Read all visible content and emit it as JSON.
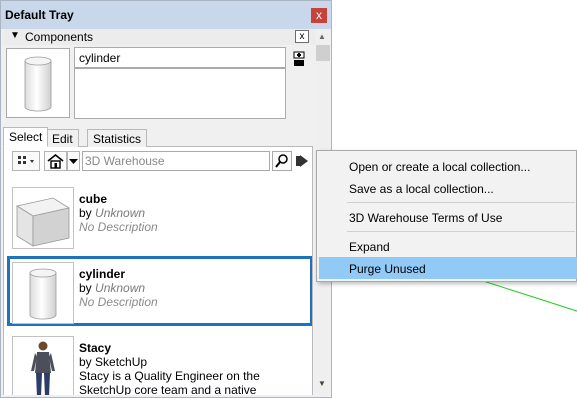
{
  "window": {
    "title": "Default Tray",
    "close_glyph": "x"
  },
  "panel": {
    "title": "Components",
    "collapse_glyph": "▼",
    "close_glyph": "x"
  },
  "preview": {
    "name_value": "cylinder",
    "description_value": ""
  },
  "tabs": [
    {
      "label": "Select",
      "active": true
    },
    {
      "label": "Edit",
      "active": false
    },
    {
      "label": "Statistics",
      "active": false
    }
  ],
  "toolbar": {
    "search_placeholder": "3D Warehouse"
  },
  "components": [
    {
      "name": "cube",
      "by_prefix": "by",
      "author": "Unknown",
      "description": "No Description",
      "selected": false
    },
    {
      "name": "cylinder",
      "by_prefix": "by",
      "author": "Unknown",
      "description": "No Description",
      "selected": true
    },
    {
      "name": "Stacy",
      "by_prefix": "by",
      "author": "SketchUp",
      "description": "Stacy is a Quality Engineer on the SketchUp core team and a native Coloradan. When she's...",
      "selected": false
    }
  ],
  "menu": {
    "items": [
      {
        "label": "Open or create a local collection..."
      },
      {
        "label": "Save as a local collection..."
      },
      {
        "label": "3D Warehouse Terms of Use"
      },
      {
        "label": "Expand"
      },
      {
        "label": "Purge Unused",
        "highlighted": true
      }
    ]
  },
  "colors": {
    "selection_border": "#1e73be",
    "menu_highlight": "#91c9f7",
    "titlebar": "#c9d7ea",
    "axis_line": "#00cc00"
  }
}
